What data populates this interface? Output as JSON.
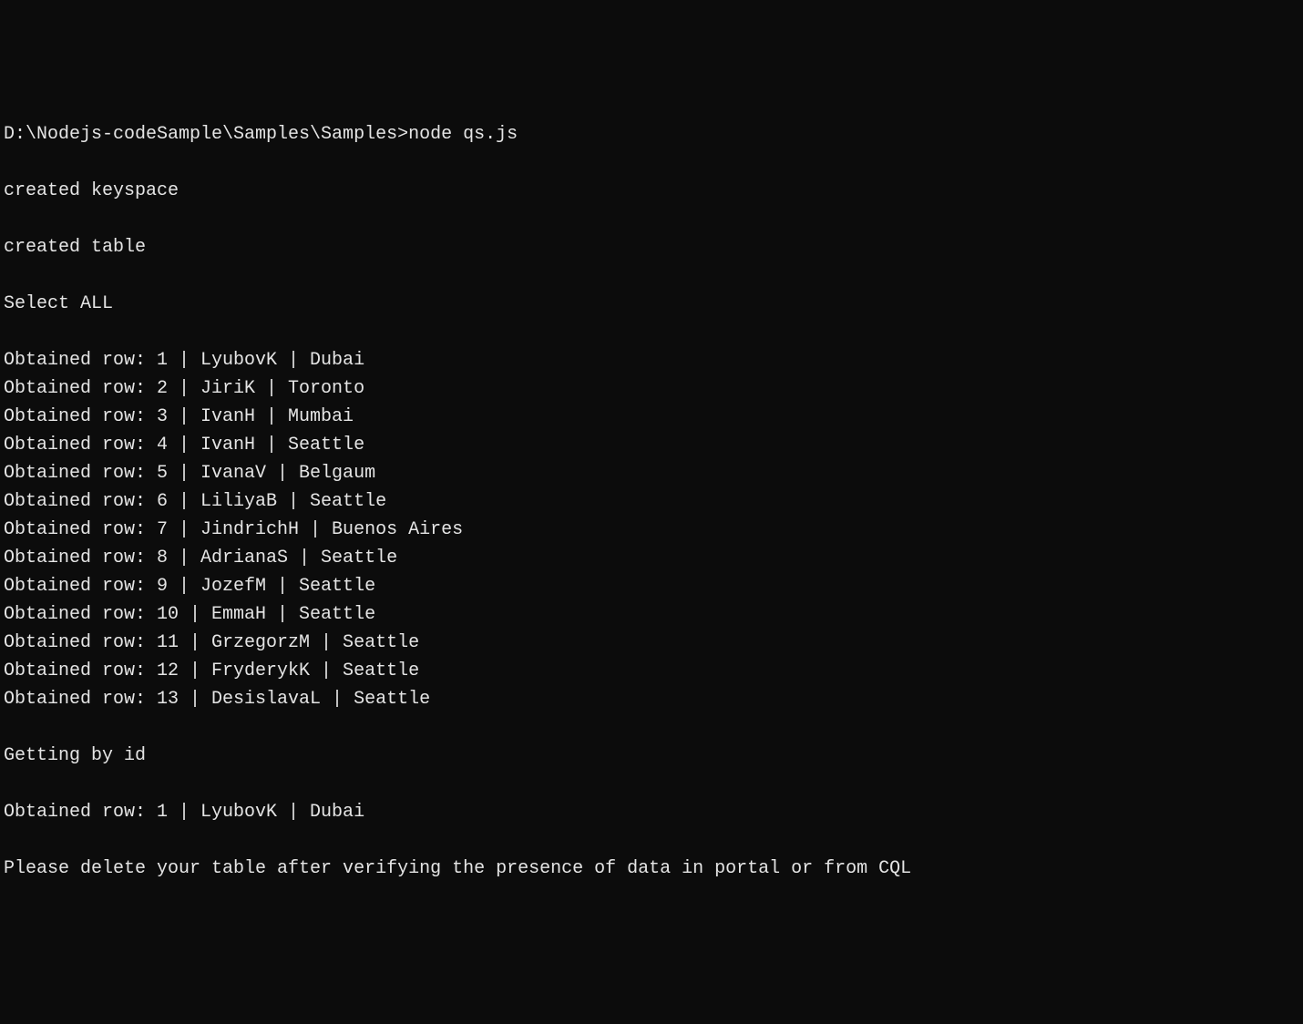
{
  "prompt": {
    "path": "D:\\Nodejs-codeSample\\Samples\\Samples>",
    "command": "node qs.js"
  },
  "output": {
    "created_keyspace": "created keyspace",
    "created_table": "created table",
    "select_all": "Select ALL",
    "rows": [
      {
        "prefix": "Obtained row: ",
        "id": "1",
        "name": "LyubovK",
        "city": "Dubai"
      },
      {
        "prefix": "Obtained row: ",
        "id": "2",
        "name": "JiriK",
        "city": "Toronto"
      },
      {
        "prefix": "Obtained row: ",
        "id": "3",
        "name": "IvanH",
        "city": "Mumbai"
      },
      {
        "prefix": "Obtained row: ",
        "id": "4",
        "name": "IvanH",
        "city": "Seattle"
      },
      {
        "prefix": "Obtained row: ",
        "id": "5",
        "name": "IvanaV",
        "city": "Belgaum"
      },
      {
        "prefix": "Obtained row: ",
        "id": "6",
        "name": "LiliyaB",
        "city": "Seattle"
      },
      {
        "prefix": "Obtained row: ",
        "id": "7",
        "name": "JindrichH",
        "city": "Buenos Aires"
      },
      {
        "prefix": "Obtained row: ",
        "id": "8",
        "name": "AdrianaS",
        "city": "Seattle"
      },
      {
        "prefix": "Obtained row: ",
        "id": "9",
        "name": "JozefM",
        "city": "Seattle"
      },
      {
        "prefix": "Obtained row: ",
        "id": "10",
        "name": "EmmaH",
        "city": "Seattle"
      },
      {
        "prefix": "Obtained row: ",
        "id": "11",
        "name": "GrzegorzM",
        "city": "Seattle"
      },
      {
        "prefix": "Obtained row: ",
        "id": "12",
        "name": "FryderykK",
        "city": "Seattle"
      },
      {
        "prefix": "Obtained row: ",
        "id": "13",
        "name": "DesislavaL",
        "city": "Seattle"
      }
    ],
    "getting_by_id": "Getting by id",
    "by_id_row": {
      "prefix": "Obtained row: ",
      "id": "1",
      "name": "LyubovK",
      "city": "Dubai"
    },
    "final_message": "Please delete your table after verifying the presence of data in portal or from CQL"
  }
}
